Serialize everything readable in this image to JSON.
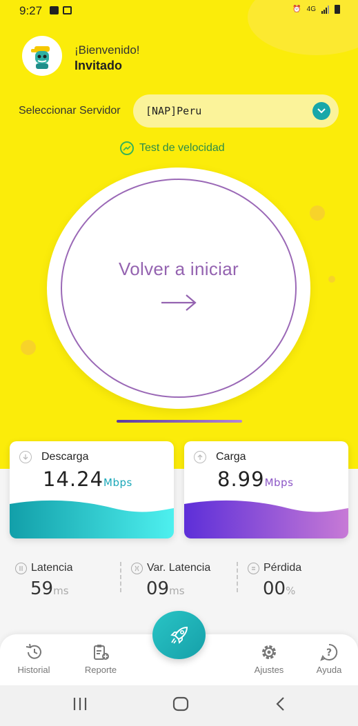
{
  "status_bar": {
    "time": "9:27",
    "network": "4G"
  },
  "header": {
    "welcome": "¡Bienvenido!",
    "username": "Invitado"
  },
  "server": {
    "label": "Seleccionar Servidor",
    "selected": "[NAP]Peru"
  },
  "speedtest_link": "Test de velocidad",
  "main_button": {
    "label": "Volver a iniciar"
  },
  "download": {
    "label": "Descarga",
    "value": "14.24",
    "unit": "Mbps"
  },
  "upload": {
    "label": "Carga",
    "value": "8.99",
    "unit": "Mbps"
  },
  "stats": {
    "latency": {
      "label": "Latencia",
      "value": "59",
      "unit": "ms"
    },
    "jitter": {
      "label": "Var. Latencia",
      "value": "09",
      "unit": "ms"
    },
    "loss": {
      "label": "Pérdida",
      "value": "00",
      "unit": "%"
    }
  },
  "nav": {
    "history": "Historial",
    "report": "Reporte",
    "settings": "Ajustes",
    "help": "Ayuda"
  },
  "colors": {
    "background": "#fbec0a",
    "accent_teal": "#18a7a9",
    "accent_purple": "#9463b0"
  }
}
